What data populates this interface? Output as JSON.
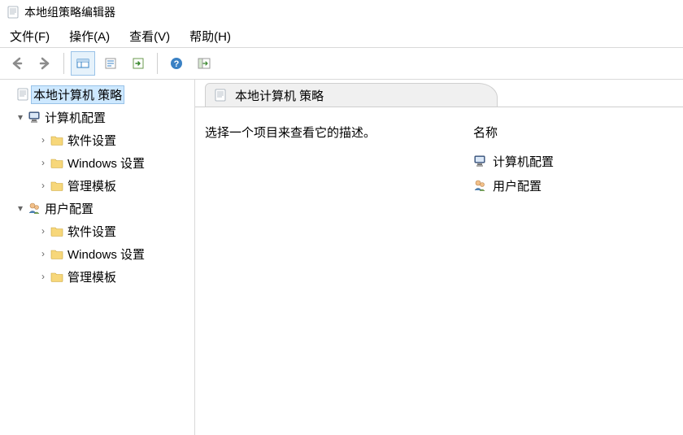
{
  "window": {
    "title": "本地组策略编辑器"
  },
  "menu": {
    "file": "文件(F)",
    "action": "操作(A)",
    "view": "查看(V)",
    "help": "帮助(H)"
  },
  "tree": {
    "root": "本地计算机 策略",
    "computer": "计算机配置",
    "software": "软件设置",
    "windows_settings": "Windows 设置",
    "admin_templates": "管理模板",
    "user": "用户配置"
  },
  "details": {
    "header_title": "本地计算机 策略",
    "description_prompt": "选择一个项目来查看它的描述。",
    "column_name": "名称",
    "item_computer": "计算机配置",
    "item_user": "用户配置"
  }
}
